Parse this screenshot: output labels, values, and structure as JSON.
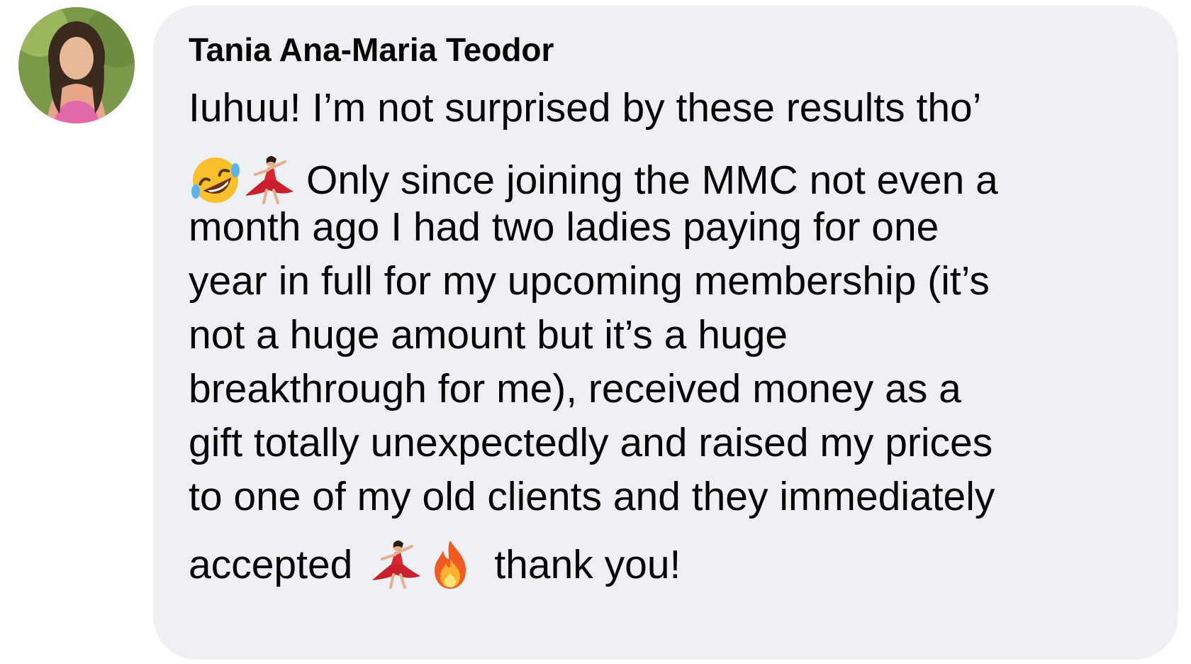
{
  "comment": {
    "author": "Tania Ana-Maria Teodor",
    "avatar_icon": "profile-photo",
    "lines": [
      "Iuhuu! I’m not surprised by these results tho’",
      "Only since joining the MMC not even a",
      "month ago I had two ladies paying for one",
      "year in full for my upcoming membership (it’s",
      "not a huge amount but it’s a huge",
      "breakthrough for me), received money as a",
      "gift totally unexpectedly and raised my prices",
      "to one of my old clients and they immediately",
      "accepted",
      "thank you!"
    ],
    "emojis": [
      "rolling-on-floor-laughing-emoji",
      "dancer-emoji",
      "dancer-emoji",
      "fire-emoji"
    ]
  },
  "colors": {
    "bubble_background": "#eff0f4",
    "text": "#050505"
  }
}
